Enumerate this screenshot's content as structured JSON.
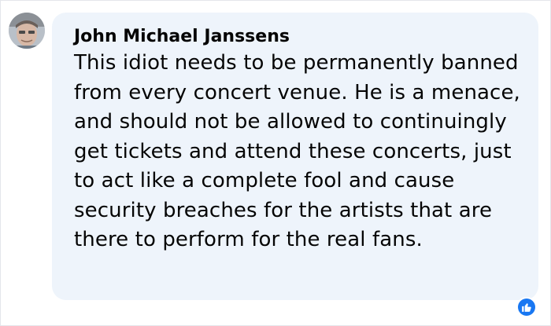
{
  "comment": {
    "author": "John Michael Janssens",
    "text": "This idiot needs to be permanently banned from every concert venue. He is a menace, and should not be allowed to continuingly get tickets and attend these concerts, just to act like a complete fool and cause security breaches for the artists that are there to perform for the real fans.",
    "reaction_icon": "like-icon",
    "bubble_color": "#eef4fb",
    "reaction_color": "#1877f2"
  }
}
